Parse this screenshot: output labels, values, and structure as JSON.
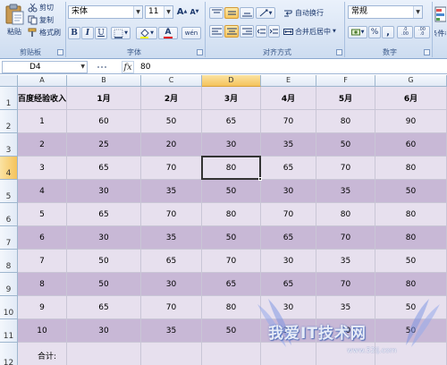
{
  "ribbon": {
    "clipboard": {
      "paste_label": "粘贴",
      "cut_label": "剪切",
      "copy_label": "复制",
      "format_painter_label": "格式刷",
      "group_label": "剪贴板"
    },
    "font": {
      "font_name": "宋体",
      "font_size": "11",
      "grow_label": "A",
      "shrink_label": "A",
      "bold_label": "B",
      "italic_label": "I",
      "underline_label": "U",
      "font_color_label": "A",
      "phonetic_label": "wén",
      "group_label": "字体"
    },
    "alignment": {
      "wrap_text_label": "自动换行",
      "merge_center_label": "合并后居中",
      "group_label": "对齐方式"
    },
    "number": {
      "format_value": "常规",
      "percent_label": "%",
      "comma_label": ",",
      "increase_decimal_label": ".0 .00",
      "decrease_decimal_label": ".00 .0",
      "group_label": "数字"
    },
    "styles": {
      "conditional_format_label": "条件格"
    }
  },
  "formula_bar": {
    "name_box": "D4",
    "fx_label": "fx",
    "content": "80"
  },
  "sheet": {
    "columns": [
      "A",
      "B",
      "C",
      "D",
      "E",
      "F",
      "G"
    ],
    "selected_column": "D",
    "rows": [
      "1",
      "2",
      "3",
      "4",
      "5",
      "6",
      "7",
      "8",
      "9",
      "10",
      "11",
      "12"
    ],
    "selected_row": "4",
    "header_row": [
      "百度经验收入",
      "1月",
      "2月",
      "3月",
      "4月",
      "5月",
      "6月"
    ],
    "data_rows": [
      [
        "1",
        "60",
        "50",
        "65",
        "70",
        "80",
        "90"
      ],
      [
        "2",
        "25",
        "20",
        "30",
        "35",
        "50",
        "60"
      ],
      [
        "3",
        "65",
        "70",
        "80",
        "65",
        "70",
        "80"
      ],
      [
        "4",
        "30",
        "35",
        "50",
        "30",
        "35",
        "50"
      ],
      [
        "5",
        "65",
        "70",
        "80",
        "70",
        "80",
        "80"
      ],
      [
        "6",
        "30",
        "35",
        "50",
        "65",
        "70",
        "80"
      ],
      [
        "7",
        "50",
        "65",
        "70",
        "30",
        "35",
        "50"
      ],
      [
        "8",
        "50",
        "30",
        "65",
        "65",
        "70",
        "80"
      ],
      [
        "9",
        "65",
        "70",
        "80",
        "30",
        "35",
        "50"
      ],
      [
        "10",
        "30",
        "35",
        "50",
        "35",
        "50",
        "50"
      ]
    ],
    "total_label": "合计:"
  },
  "watermark": {
    "text": "我爱IT技术网",
    "url": "www.52ij.com"
  },
  "colors": {
    "row_light": "#e7e0ee",
    "row_dark": "#c8b8d6",
    "selection_header": "#f5c35b",
    "ribbon_bg": "#dbe6f5"
  }
}
